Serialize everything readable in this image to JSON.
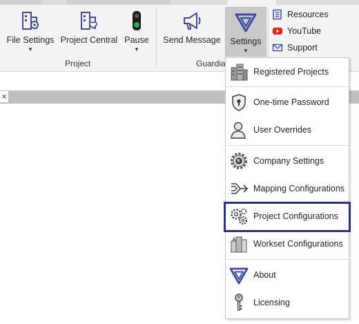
{
  "ribbon": {
    "buttons": {
      "file_settings": "File Settings",
      "project_central": "Project Central",
      "pause": "Pause",
      "send_message": "Send Message",
      "settings": "Settings"
    },
    "group_labels": {
      "project": "Project",
      "guardian": "Guardian"
    },
    "side_links": {
      "resources": "Resources",
      "youtube": "YouTube",
      "support": "Support"
    }
  },
  "settings_menu": {
    "items": [
      {
        "label": "Registered Projects",
        "icon": "buildings-icon"
      },
      {
        "label": "One-time Password",
        "icon": "shield-lock-icon"
      },
      {
        "label": "User Overrides",
        "icon": "user-icon"
      },
      {
        "label": "Company Settings",
        "icon": "gear-globe-icon"
      },
      {
        "label": "Mapping Configurations",
        "icon": "merge-arrows-icon"
      },
      {
        "label": "Project Configurations",
        "icon": "gears-icon",
        "highlighted": true
      },
      {
        "label": "Workset Configurations",
        "icon": "worksets-icon"
      },
      {
        "label": "About",
        "icon": "guardian-logo-icon"
      },
      {
        "label": "Licensing",
        "icon": "key-icon"
      }
    ]
  },
  "doc_tab": {
    "close_glyph": "×"
  },
  "colors": {
    "accent_navy": "#2a2f88",
    "icon_blue": "#3d4aa6",
    "youtube_red": "#e62117",
    "traffic_green": "#2db336"
  }
}
